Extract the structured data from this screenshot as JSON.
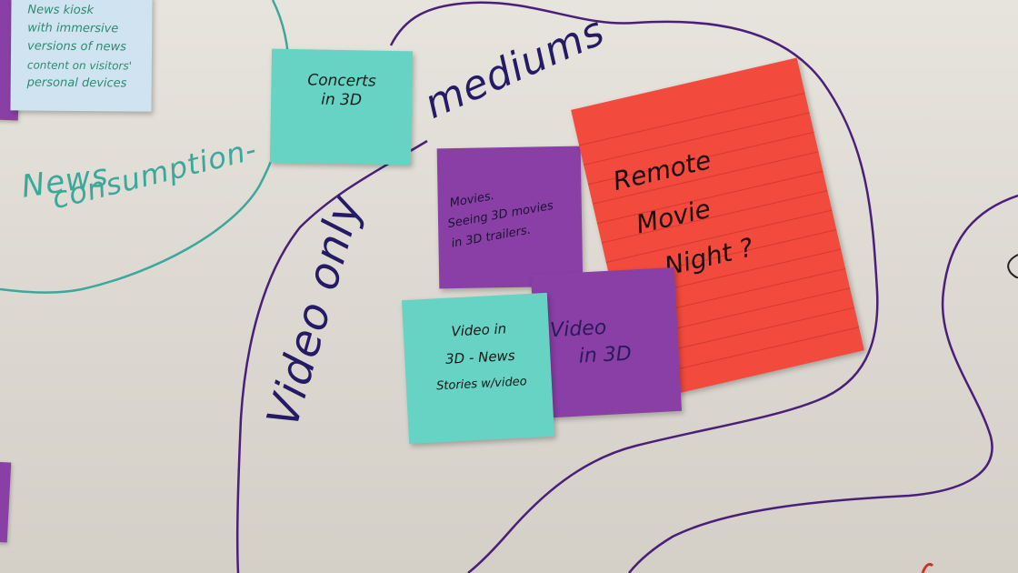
{
  "board": {
    "colors": {
      "surface": "#e3e0d9",
      "teal_ink": "#3aa89a",
      "purple_ink": "#4a1f7a",
      "navy_ink": "#241a66",
      "teal_note": "#66d3c4",
      "purple_note": "#8a3fa6",
      "red_note": "#f24a3d",
      "blue_note": "#cfe3f1"
    },
    "labels": {
      "news_consumption_1": "News",
      "news_consumption_2": "consumption-",
      "video_only": "Video only",
      "mediums": "mediums"
    }
  },
  "notes": {
    "kiosk": {
      "lines": [
        "News kiosk",
        "with immersive",
        "versions of news",
        "content on visitors'",
        "personal devices"
      ]
    },
    "concerts": {
      "lines": [
        "Concerts",
        "in 3D"
      ]
    },
    "movies": {
      "lines": [
        "Movies.",
        "Seeing 3D movies",
        "in 3D trailers."
      ]
    },
    "remote": {
      "lines": [
        "Remote",
        "Movie",
        "Night ?"
      ]
    },
    "video_news": {
      "lines": [
        "Video in",
        "3D - News",
        "Stories w/video"
      ]
    },
    "video_3d": {
      "lines": [
        "Video",
        "in 3D"
      ]
    }
  }
}
